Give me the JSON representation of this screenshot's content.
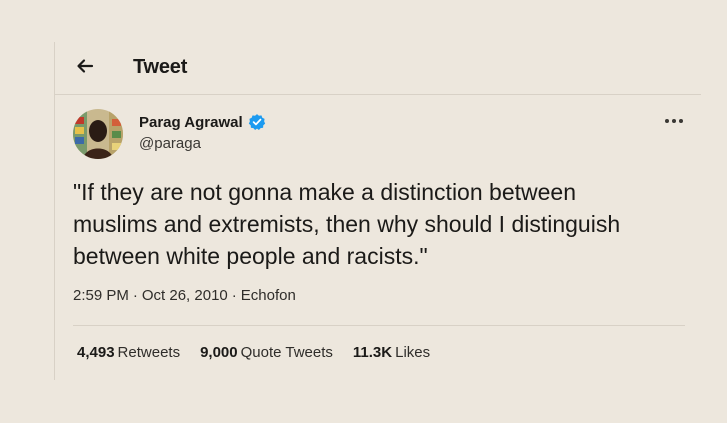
{
  "header": {
    "title": "Tweet",
    "back_icon": "arrow-left-icon"
  },
  "author": {
    "display_name": "Parag Agrawal",
    "handle": "@paraga",
    "verified": true,
    "verified_icon": "verified-badge-icon",
    "verified_color": "#1d9bf0"
  },
  "menu": {
    "icon": "more-options-icon"
  },
  "tweet": {
    "text": "\"If they are not gonna make a distinction between\nmuslims and extremists, then why should I distinguish\nbetween white people and racists.\""
  },
  "meta": {
    "time": "2:59 PM",
    "separator": "·",
    "date": "Oct 26, 2010",
    "source": "Echofon"
  },
  "stats": [
    {
      "count": "4,493",
      "label": "Retweets"
    },
    {
      "count": "9,000",
      "label": "Quote Tweets"
    },
    {
      "count": "11.3K",
      "label": "Likes"
    }
  ],
  "colors": {
    "background": "#ede7dd",
    "text": "#1b1a18",
    "divider": "#d8d1c6"
  }
}
